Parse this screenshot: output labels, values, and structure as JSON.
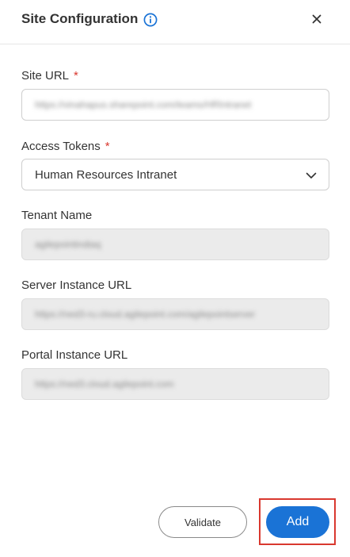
{
  "header": {
    "title": "Site Configuration",
    "info_icon": "info-circle-icon",
    "close_icon": "close-icon"
  },
  "fields": {
    "site_url": {
      "label": "Site URL",
      "required": "*",
      "value": "https://vinahapus.sharepoint.com/teams/HRIntranet"
    },
    "access_tokens": {
      "label": "Access Tokens",
      "required": "*",
      "value": "Human Resources Intranet"
    },
    "tenant_name": {
      "label": "Tenant Name",
      "value": "agilepointindiaq"
    },
    "server_instance_url": {
      "label": "Server Instance URL",
      "value": "https://ned3-ru.cloud.agilepoint.com/agilepointserver"
    },
    "portal_instance_url": {
      "label": "Portal Instance URL",
      "value": "https://ned3.cloud.agilepoint.com"
    }
  },
  "footer": {
    "validate_label": "Validate",
    "add_label": "Add"
  },
  "colors": {
    "accent": "#1a73d6",
    "required": "#d9382f",
    "highlight_outline": "#d9382f",
    "readonly_bg": "#ebebeb"
  }
}
